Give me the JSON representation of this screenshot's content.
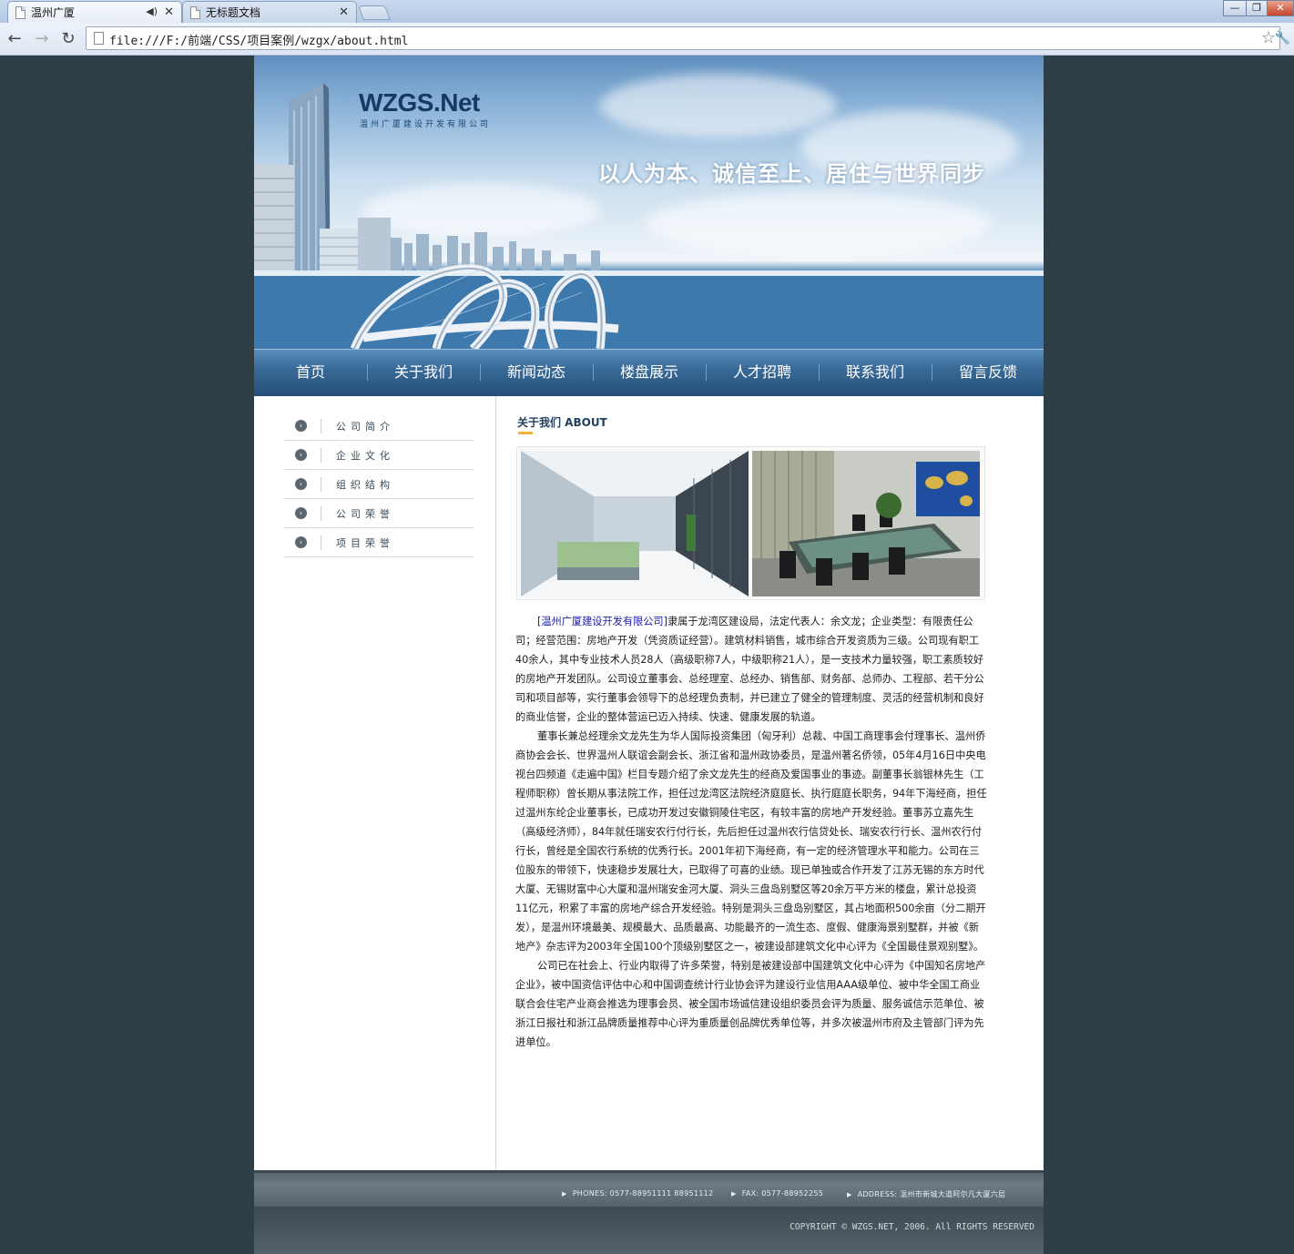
{
  "browser": {
    "tabs": [
      {
        "title": "温州广厦",
        "active": true
      },
      {
        "title": "无标题文档",
        "active": false
      }
    ],
    "url": "file:///F:/前端/CSS/项目案例/wzgx/about.html"
  },
  "header": {
    "logo_main": "WZGS.Net",
    "logo_sub": "温州广厦建设开发有限公司",
    "slogan": "以人为本、诚信至上、居住与世界同步"
  },
  "nav": {
    "items": [
      "首页",
      "关于我们",
      "新闻动态",
      "楼盘展示",
      "人才招聘",
      "联系我们",
      "留言反馈"
    ]
  },
  "sidebar": {
    "items": [
      "公司简介",
      "企业文化",
      "组织结构",
      "公司荣誉",
      "项目荣誉"
    ]
  },
  "content": {
    "title": "关于我们 ABOUT",
    "company_link": "[温州广厦建设开发有限公司]",
    "p1_rest": "隶属于龙湾区建设局，法定代表人：余文龙；企业类型：有限责任公司；经营范围：房地产开发（凭资质证经营）。建筑材料销售，城市综合开发资质为三级。公司现有职工40余人，其中专业技术人员28人（高级职称7人，中级职称21人），是一支技术力量较强，职工素质较好的房地产开发团队。公司设立董事会、总经理室、总经办、销售部、财务部、总师办、工程部、若干分公司和项目部等，实行董事会领导下的总经理负责制，并已建立了健全的管理制度、灵活的经营机制和良好的商业信誉，企业的整体营运已迈入持续、快速、健康发展的轨道。",
    "p2": "董事长兼总经理余文龙先生为华人国际投资集团（匈牙利）总裁、中国工商理事会付理事长、温州侨商协会会长、世界温州人联谊会副会长、浙江省和温州政协委员，是温州著名侨领，05年4月16日中央电视台四频道《走遍中国》栏目专题介绍了余文龙先生的经商及爱国事业的事迹。副董事长翁银林先生（工程师职称）曾长期从事法院工作，担任过龙湾区法院经济庭庭长、执行庭庭长职务，94年下海经商，担任过温州东纶企业董事长，已成功开发过安徽铜陵住宅区，有较丰富的房地产开发经验。董事苏立嘉先生（高级经济师），84年就任瑞安农行付行长，先后担任过温州农行信贷处长、瑞安农行行长、温州农行付行长，曾经是全国农行系统的优秀行长。2001年初下海经商，有一定的经济管理水平和能力。公司在三位股东的带领下，快速稳步发展壮大，已取得了可喜的业绩。现已单独或合作开发了江苏无锡的东方时代大厦、无锡财富中心大厦和温州瑞安金河大厦、洞头三盘岛别墅区等20余万平方米的楼盘，累计总投资11亿元，积累了丰富的房地产综合开发经验。特别是洞头三盘岛别墅区，其占地面积500余亩（分二期开发），是温州环境最美、规模最大、品质最高、功能最齐的一流生态、度假、健康海景别墅群，并被《新地产》杂志评为2003年全国100个顶级别墅区之一，被建设部建筑文化中心评为《全国最佳景观别墅》。",
    "p3": "公司已在社会上、行业内取得了许多荣誉，特别是被建设部中国建筑文化中心评为《中国知名房地产企业》，被中国资信评估中心和中国调查统计行业协会评为建设行业信用AAA级单位、被中华全国工商业联合会住宅产业商会推选为理事会员、被全国市场诚信建设组织委员会评为质量、服务诚信示范单位、被浙江日报社和浙江品牌质量推荐中心评为重质量创品牌优秀单位等，并多次被温州市府及主管部门评为先进单位。"
  },
  "footer": {
    "phones": "PHONES: 0577-88951111 88951112",
    "fax": "FAX: 0577-88952255",
    "address": "ADDRESS: 温州市新城大道阿尔凡大厦六层",
    "copyright": "COPYRIGHT © WZGS.NET, 2006. All RIGHTS RESERVED"
  },
  "colors": {
    "nav": "#2d5f8e",
    "page_bg": "#2e3e47",
    "title": "#22405e",
    "accent": "#f0b23a",
    "link": "#1d1da8"
  }
}
